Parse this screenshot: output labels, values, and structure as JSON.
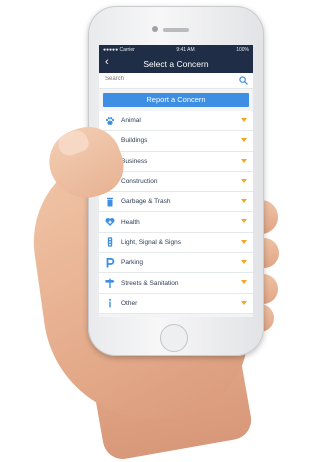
{
  "status_bar": {
    "carrier": "●●●●● Carrier",
    "time": "9:41 AM",
    "battery": "100%"
  },
  "nav": {
    "back_glyph": "‹",
    "title": "Select a Concern"
  },
  "search": {
    "placeholder": "Search"
  },
  "report_button": "Report a Concern",
  "categories": [
    {
      "label": "Animal",
      "icon": "paw-icon"
    },
    {
      "label": "Buildings",
      "icon": "building-icon"
    },
    {
      "label": "Business",
      "icon": "store-icon"
    },
    {
      "label": "Construction",
      "icon": "construction-sign-icon"
    },
    {
      "label": "Garbage & Trash",
      "icon": "trash-can-icon"
    },
    {
      "label": "Health",
      "icon": "heart-icon"
    },
    {
      "label": "Light, Signal & Signs",
      "icon": "traffic-light-icon"
    },
    {
      "label": "Parking",
      "icon": "parking-icon"
    },
    {
      "label": "Streets & Sanitation",
      "icon": "street-sign-icon"
    },
    {
      "label": "Other",
      "icon": "info-icon"
    }
  ],
  "colors": {
    "nav_bg": "#1f2d46",
    "accent_blue": "#3e8ee3",
    "chevron_orange": "#f5a623",
    "label_text": "#2f3d55"
  }
}
